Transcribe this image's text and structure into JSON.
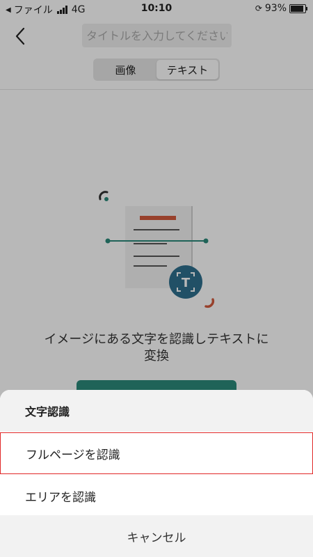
{
  "status_bar": {
    "carrier": "ファイル",
    "network": "4G",
    "time": "10:10",
    "battery": "93%"
  },
  "header": {
    "title_placeholder": "タイトルを入力してください"
  },
  "tabs": [
    {
      "label": "画像",
      "active": false
    },
    {
      "label": "テキスト",
      "active": true
    }
  ],
  "main": {
    "description": "イメージにある文字を認識しテキストに変換"
  },
  "sheet": {
    "title": "文字認識",
    "options": [
      {
        "label": "フルページを認識"
      },
      {
        "label": "エリアを認識"
      }
    ],
    "cancel": "キャンセル"
  },
  "colors": {
    "accent": "#2b8a7a",
    "ocr_badge": "#2e6f8e",
    "highlight": "#e12727",
    "doc_red": "#d35b3e"
  },
  "icons": {
    "back": "back-arrow-icon",
    "ocr": "text-scan-icon"
  }
}
